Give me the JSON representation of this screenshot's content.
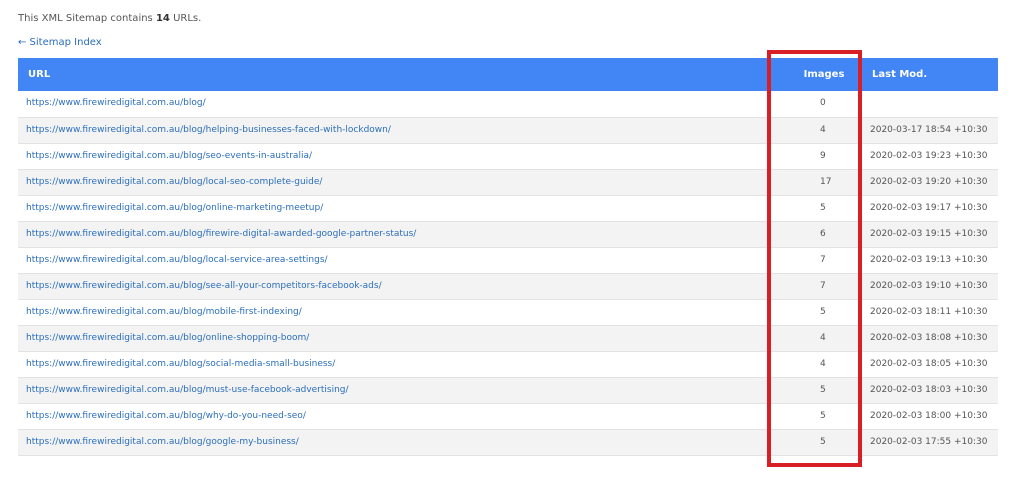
{
  "intro": {
    "prefix": "This XML Sitemap contains",
    "count": "14",
    "suffix": "URLs."
  },
  "back_link": "← Sitemap Index",
  "table": {
    "headers": {
      "url": "URL",
      "images": "Images",
      "last_mod": "Last Mod."
    },
    "rows": [
      {
        "url": "https://www.firewiredigital.com.au/blog/",
        "images": "0",
        "last_mod": ""
      },
      {
        "url": "https://www.firewiredigital.com.au/blog/helping-businesses-faced-with-lockdown/",
        "images": "4",
        "last_mod": "2020-03-17 18:54 +10:30"
      },
      {
        "url": "https://www.firewiredigital.com.au/blog/seo-events-in-australia/",
        "images": "9",
        "last_mod": "2020-02-03 19:23 +10:30"
      },
      {
        "url": "https://www.firewiredigital.com.au/blog/local-seo-complete-guide/",
        "images": "17",
        "last_mod": "2020-02-03 19:20 +10:30"
      },
      {
        "url": "https://www.firewiredigital.com.au/blog/online-marketing-meetup/",
        "images": "5",
        "last_mod": "2020-02-03 19:17 +10:30"
      },
      {
        "url": "https://www.firewiredigital.com.au/blog/firewire-digital-awarded-google-partner-status/",
        "images": "6",
        "last_mod": "2020-02-03 19:15 +10:30"
      },
      {
        "url": "https://www.firewiredigital.com.au/blog/local-service-area-settings/",
        "images": "7",
        "last_mod": "2020-02-03 19:13 +10:30"
      },
      {
        "url": "https://www.firewiredigital.com.au/blog/see-all-your-competitors-facebook-ads/",
        "images": "7",
        "last_mod": "2020-02-03 19:10 +10:30"
      },
      {
        "url": "https://www.firewiredigital.com.au/blog/mobile-first-indexing/",
        "images": "5",
        "last_mod": "2020-02-03 18:11 +10:30"
      },
      {
        "url": "https://www.firewiredigital.com.au/blog/online-shopping-boom/",
        "images": "4",
        "last_mod": "2020-02-03 18:08 +10:30"
      },
      {
        "url": "https://www.firewiredigital.com.au/blog/social-media-small-business/",
        "images": "4",
        "last_mod": "2020-02-03 18:05 +10:30"
      },
      {
        "url": "https://www.firewiredigital.com.au/blog/must-use-facebook-advertising/",
        "images": "5",
        "last_mod": "2020-02-03 18:03 +10:30"
      },
      {
        "url": "https://www.firewiredigital.com.au/blog/why-do-you-need-seo/",
        "images": "5",
        "last_mod": "2020-02-03 18:00 +10:30"
      },
      {
        "url": "https://www.firewiredigital.com.au/blog/google-my-business/",
        "images": "5",
        "last_mod": "2020-02-03 17:55 +10:30"
      }
    ]
  },
  "colors": {
    "header_bg": "#4285f4",
    "link": "#2a6ebb",
    "highlight_border": "#d91f26"
  }
}
